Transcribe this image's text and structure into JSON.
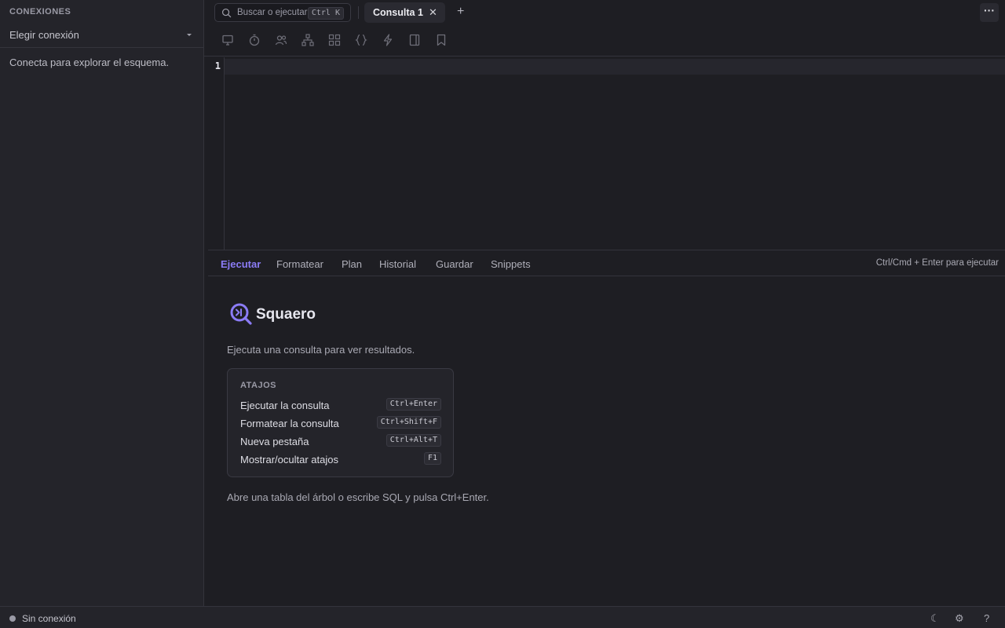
{
  "sidebar": {
    "title": "CONEXIONES",
    "connection_select": "Elegir conexión",
    "empty_message": "Conecta para explorar el esquema."
  },
  "topbar": {
    "search_placeholder": "Buscar o ejecutar",
    "search_shortcut": "Ctrl K",
    "tab_label": "Consulta 1",
    "tab_close": "✕",
    "add_tab": "+",
    "more": "···"
  },
  "toolbar": {
    "icons": [
      "monitor-icon",
      "timer-icon",
      "users-icon",
      "hierarchy-icon",
      "grid-icon",
      "braces-icon",
      "bolt-icon",
      "sidebar-panel-icon",
      "bookmark-icon"
    ]
  },
  "editor": {
    "line_number": "1"
  },
  "results": {
    "tabs": [
      "Ejecutar",
      "Formatear",
      "Plan",
      "Historial",
      "Guardar",
      "Snippets"
    ],
    "active_tab": "Ejecutar",
    "hint": "Ctrl/Cmd + Enter para ejecutar",
    "brand": "Squaero",
    "message": "Ejecuta una consulta para ver resultados.",
    "shortcuts_title": "ATAJOS",
    "shortcuts": [
      {
        "label": "Ejecutar la consulta",
        "keys": "Ctrl+Enter"
      },
      {
        "label": "Formatear la consulta",
        "keys": "Ctrl+Shift+F"
      },
      {
        "label": "Nueva pestaña",
        "keys": "Ctrl+Alt+T"
      },
      {
        "label": "Mostrar/ocultar atajos",
        "keys": "F1"
      }
    ],
    "footer": "Abre una tabla del árbol o escribe SQL y pulsa Ctrl+Enter."
  },
  "statusbar": {
    "status": "Sin conexión",
    "theme_icon": "☾",
    "settings_icon": "⚙",
    "help_icon": "?"
  },
  "colors": {
    "accent": "#8b7cf6",
    "background": "#1e1e23",
    "panel": "#24242a"
  }
}
